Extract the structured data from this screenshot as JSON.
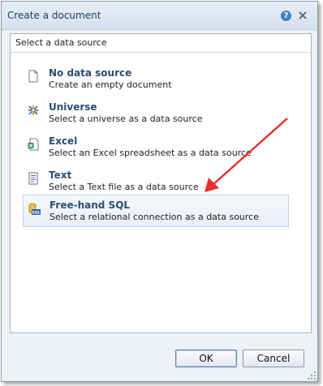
{
  "dialog": {
    "title": "Create a document",
    "help_label": "?",
    "section_label": "Select a data source",
    "ok_label": "OK",
    "cancel_label": "Cancel"
  },
  "options": [
    {
      "title": "No data source",
      "description": "Create an empty document",
      "icon": "blank-document-icon"
    },
    {
      "title": "Universe",
      "description": "Select a universe as a data source",
      "icon": "universe-icon"
    },
    {
      "title": "Excel",
      "description": "Select an Excel spreadsheet as a data source",
      "icon": "excel-icon"
    },
    {
      "title": "Text",
      "description": "Select a Text file as a data source",
      "icon": "text-file-icon"
    },
    {
      "title": "Free-hand SQL",
      "description": "Select a relational connection as a data source",
      "icon": "sql-icon",
      "selected": true
    }
  ],
  "colors": {
    "title_text": "#1f3a5c",
    "option_title": "#2a4d73",
    "annotation_arrow": "#e8312f"
  }
}
